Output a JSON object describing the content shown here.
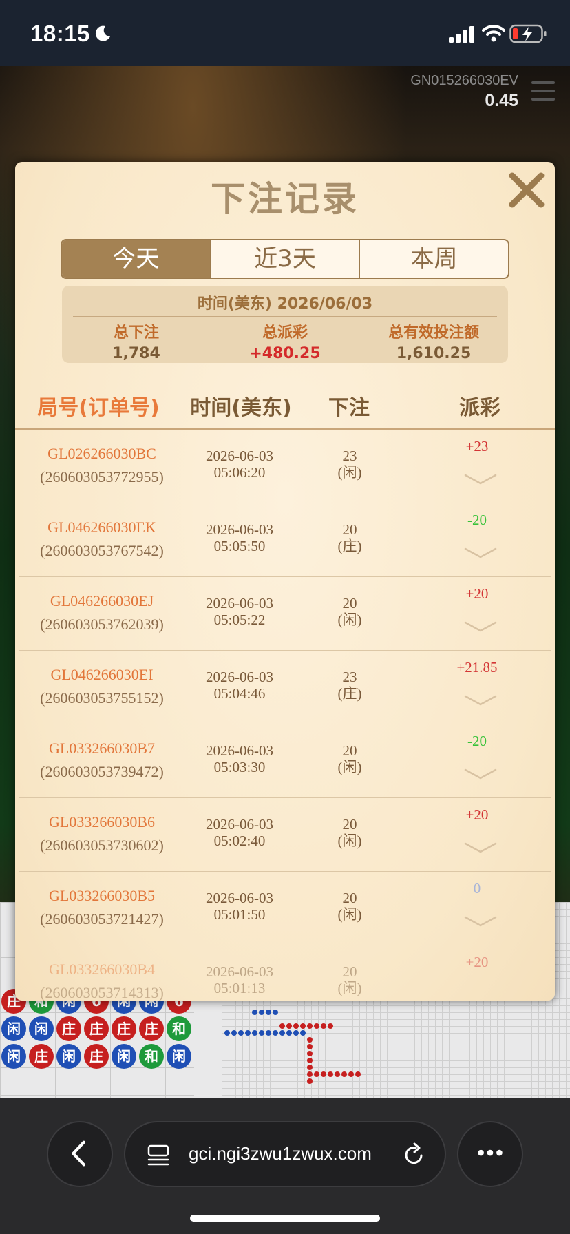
{
  "status_bar": {
    "time": "18:15"
  },
  "game": {
    "table_id": "GN015266030EV",
    "balance": "0.45"
  },
  "modal": {
    "title": "下注记录",
    "tabs": [
      {
        "label": "今天",
        "active": true
      },
      {
        "label": "近3天",
        "active": false
      },
      {
        "label": "本周",
        "active": false
      }
    ],
    "summary": {
      "date_label": "时间(美东)  2026/06/03",
      "total_bet_label": "总下注",
      "total_bet_value": "1,784",
      "total_payout_label": "总派彩",
      "total_payout_value": "+480.25",
      "total_valid_label": "总有效投注额",
      "total_valid_value": "1,610.25"
    },
    "columns": {
      "game_no": "局号(订单号)",
      "time": "时间(美东)",
      "bet": "下注",
      "payout": "派彩"
    },
    "rows": [
      {
        "game_id": "GL026266030BC",
        "order_no": "(260603053772955)",
        "date": "2026-06-03",
        "time": "05:06:20",
        "bet": "23",
        "side": "(闲)",
        "payout": "+23",
        "sign": "pos"
      },
      {
        "game_id": "GL046266030EK",
        "order_no": "(260603053767542)",
        "date": "2026-06-03",
        "time": "05:05:50",
        "bet": "20",
        "side": "(庄)",
        "payout": "-20",
        "sign": "neg"
      },
      {
        "game_id": "GL046266030EJ",
        "order_no": "(260603053762039)",
        "date": "2026-06-03",
        "time": "05:05:22",
        "bet": "20",
        "side": "(闲)",
        "payout": "+20",
        "sign": "pos"
      },
      {
        "game_id": "GL046266030EI",
        "order_no": "(260603053755152)",
        "date": "2026-06-03",
        "time": "05:04:46",
        "bet": "23",
        "side": "(庄)",
        "payout": "+21.85",
        "sign": "pos"
      },
      {
        "game_id": "GL033266030B7",
        "order_no": "(260603053739472)",
        "date": "2026-06-03",
        "time": "05:03:30",
        "bet": "20",
        "side": "(闲)",
        "payout": "-20",
        "sign": "neg"
      },
      {
        "game_id": "GL033266030B6",
        "order_no": "(260603053730602)",
        "date": "2026-06-03",
        "time": "05:02:40",
        "bet": "20",
        "side": "(闲)",
        "payout": "+20",
        "sign": "pos"
      },
      {
        "game_id": "GL033266030B5",
        "order_no": "(260603053721427)",
        "date": "2026-06-03",
        "time": "05:01:50",
        "bet": "20",
        "side": "(闲)",
        "payout": "0",
        "sign": "zero"
      },
      {
        "game_id": "GL033266030B4",
        "order_no": "(260603053714313)",
        "date": "2026-06-03",
        "time": "05:01:13",
        "bet": "20",
        "side": "(闲)",
        "payout": "+20",
        "sign": "pos"
      }
    ]
  },
  "bead_road": {
    "rows": [
      [
        {
          "t": "庄",
          "c": "red"
        },
        {
          "t": "和",
          "c": "green"
        },
        {
          "t": "闲",
          "c": "blue"
        },
        {
          "t": "6",
          "c": "red"
        },
        {
          "t": "闲",
          "c": "blue"
        },
        {
          "t": "闲",
          "c": "blue"
        },
        {
          "t": "6",
          "c": "red"
        }
      ],
      [
        {
          "t": "闲",
          "c": "blue"
        },
        {
          "t": "闲",
          "c": "blue"
        },
        {
          "t": "庄",
          "c": "red"
        },
        {
          "t": "庄",
          "c": "red"
        },
        {
          "t": "庄",
          "c": "red"
        },
        {
          "t": "庄",
          "c": "red"
        },
        {
          "t": "和",
          "c": "green"
        }
      ],
      [
        {
          "t": "闲",
          "c": "blue"
        },
        {
          "t": "庄",
          "c": "red"
        },
        {
          "t": "闲",
          "c": "blue"
        },
        {
          "t": "庄",
          "c": "red"
        },
        {
          "t": "闲",
          "c": "blue"
        },
        {
          "t": "和",
          "c": "green"
        },
        {
          "t": "闲",
          "c": "blue"
        }
      ]
    ]
  },
  "browser": {
    "url": "gci.ngi3zwu1zwux.com"
  },
  "colors": {
    "accent": "#a48253",
    "positive": "#d33535",
    "negative": "#38c23a",
    "link": "#e2763a"
  }
}
